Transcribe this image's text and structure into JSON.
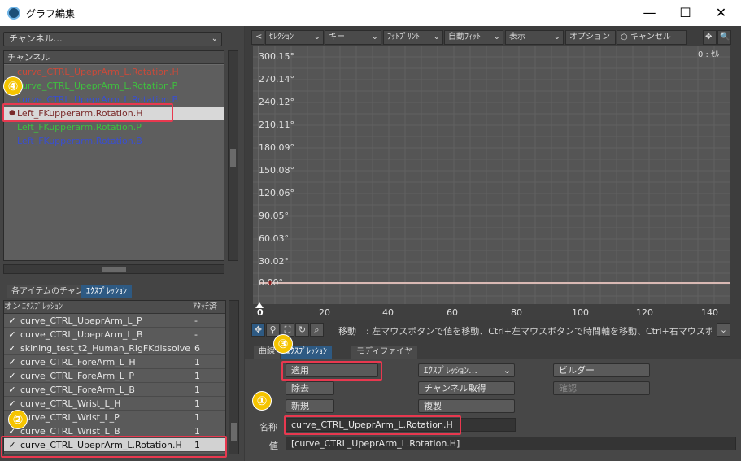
{
  "window": {
    "title": "グラフ編集",
    "minimize": "—",
    "maximize": "☐",
    "close": "✕"
  },
  "left": {
    "channel_dropdown": "チャンネル…",
    "channel_header": "チャンネル",
    "channels": [
      {
        "label": "curve_CTRL_UpeprArm_L.Rotation.H",
        "color": "#c84a3a"
      },
      {
        "label": "curve_CTRL_UpeprArm_L.Rotation.P",
        "color": "#3fbf3f"
      },
      {
        "label": "curve_CTRL_UpeprArm_L.Rotation.B",
        "color": "#3a4fcf"
      },
      {
        "label": "Left_FKupperarm.Rotation.H",
        "color": "#8a2b2b"
      },
      {
        "label": "Left_FKupperarm.Rotation.P",
        "color": "#3fbf3f"
      },
      {
        "label": "Left_FKupperarm.Rotation.B",
        "color": "#3a4fcf"
      }
    ],
    "tabs": [
      "各アイテムのチャンネル",
      "ｴｸｽﾌﾟﾚｯｼｮﾝ"
    ],
    "expr_headers": [
      "オン",
      "ｴｸｽﾌﾟﾚｯｼｮﾝ",
      "ｱﾀｯﾁ済"
    ],
    "expressions": [
      {
        "check": "✓",
        "name": "curve_CTRL_UpeprArm_L_P",
        "attached": "-"
      },
      {
        "check": "✓",
        "name": "curve_CTRL_UpeprArm_L_B",
        "attached": "-"
      },
      {
        "check": "✓",
        "name": "skining_test_t2_Human_RigFKdissolve",
        "attached": "6"
      },
      {
        "check": "✓",
        "name": "curve_CTRL_ForeArm_L_H",
        "attached": "1"
      },
      {
        "check": "✓",
        "name": "curve_CTRL_ForeArm_L_P",
        "attached": "1"
      },
      {
        "check": "✓",
        "name": "curve_CTRL_ForeArm_L_B",
        "attached": "1"
      },
      {
        "check": "✓",
        "name": "curve_CTRL_Wrist_L_H",
        "attached": "1"
      },
      {
        "check": "✓",
        "name": "curve_CTRL_Wrist_L_P",
        "attached": "1"
      },
      {
        "check": "✓",
        "name": "curve_CTRL_Wrist_L_B",
        "attached": "1"
      },
      {
        "check": "✓",
        "name": "curve_CTRL_UpeprArm_L.Rotation.H",
        "attached": "1"
      }
    ]
  },
  "toolbar": {
    "back": "<",
    "items": [
      "ｾﾚｸｼｮﾝ",
      "キー",
      "ﾌｯﾄﾌﾟﾘﾝﾄ",
      "自動ﾌｨｯﾄ",
      "表示",
      "オプション"
    ],
    "cancel_dot": "○",
    "cancel": "キャンセル",
    "undo": "+U",
    "move_icon": "✥",
    "zoom_icon": "🔍"
  },
  "graph": {
    "corner": "0 : ｾﾙ",
    "y_labels": [
      "300.15°",
      "270.14°",
      "240.12°",
      "210.11°",
      "180.09°",
      "150.08°",
      "120.06°",
      "90.05°",
      "60.03°",
      "30.02°",
      "0.00°"
    ],
    "x_labels": [
      "0",
      "20",
      "40",
      "60",
      "80",
      "100",
      "120",
      "140"
    ]
  },
  "status": {
    "label": "移動",
    "text": ":  左マウスボタンで値を移動、Ctrl+左マウスボタンで時間軸を移動、Ctrl+右マウスボタンで…"
  },
  "bottom": {
    "tabs": [
      "曲線",
      "ｴｸｽﾌﾟﾚｯｼｮﾝ",
      "モディファイヤ"
    ],
    "apply": "適用",
    "remove": "除去",
    "new": "新規",
    "expression_dropdown": "ｴｸｽﾌﾟﾚｯｼｮﾝ…",
    "get_channel": "チャンネル取得",
    "duplicate": "複製",
    "builder": "ビルダー",
    "confirm": "確認",
    "name_label": "名称",
    "name_value": "curve_CTRL_UpeprArm_L.Rotation.H",
    "value_label": "値",
    "value_value": "[curve_CTRL_UpeprArm_L.Rotation.H]"
  },
  "badges": [
    "①",
    "②",
    "③",
    "④"
  ]
}
